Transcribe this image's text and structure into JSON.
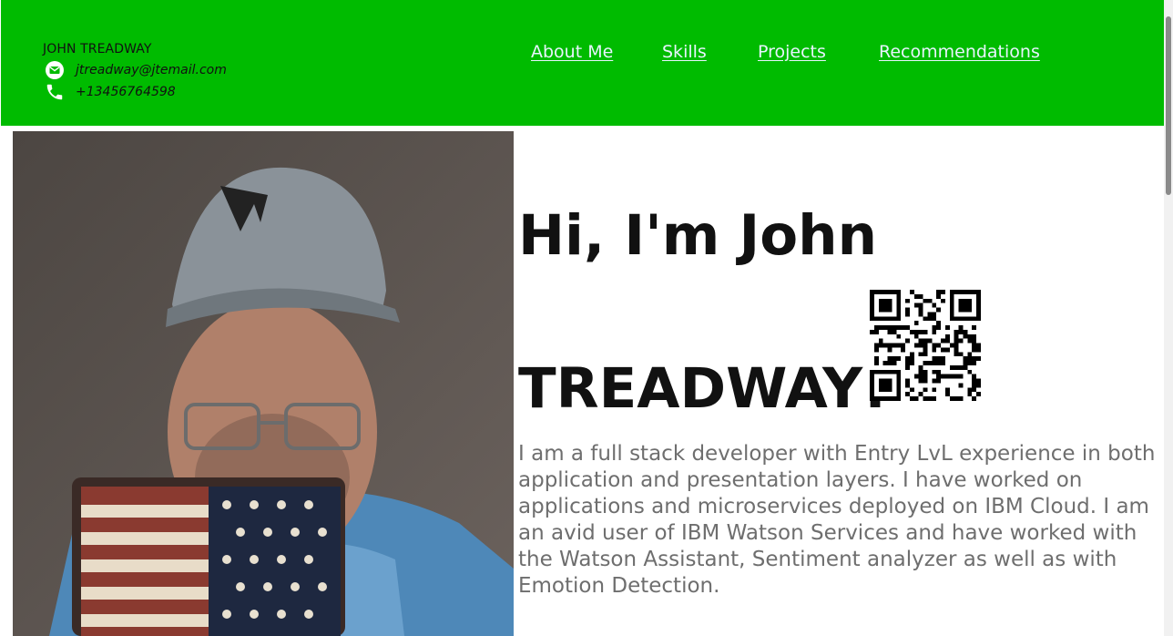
{
  "header": {
    "name": "JOHN TREADWAY",
    "email": "jtreadway@jtemail.com",
    "phone": "+13456764598",
    "background_color": "#00bb00"
  },
  "nav": {
    "items": [
      {
        "label": "About Me"
      },
      {
        "label": "Skills"
      },
      {
        "label": "Projects"
      },
      {
        "label": "Recommendations"
      }
    ]
  },
  "hero": {
    "line1": "Hi, I'm John",
    "line2": "TREADWAY!",
    "bio": "I am a full stack developer with Entry LvL experience in both application and presentation layers. I have worked on applications and microservices deployed on IBM Cloud. I am an avid user of IBM Watson Services and have worked with the Watson Assistant, Sentiment analyzer as well as with Emotion Detection."
  },
  "icons": {
    "email": "envelope-icon",
    "phone": "phone-icon"
  }
}
